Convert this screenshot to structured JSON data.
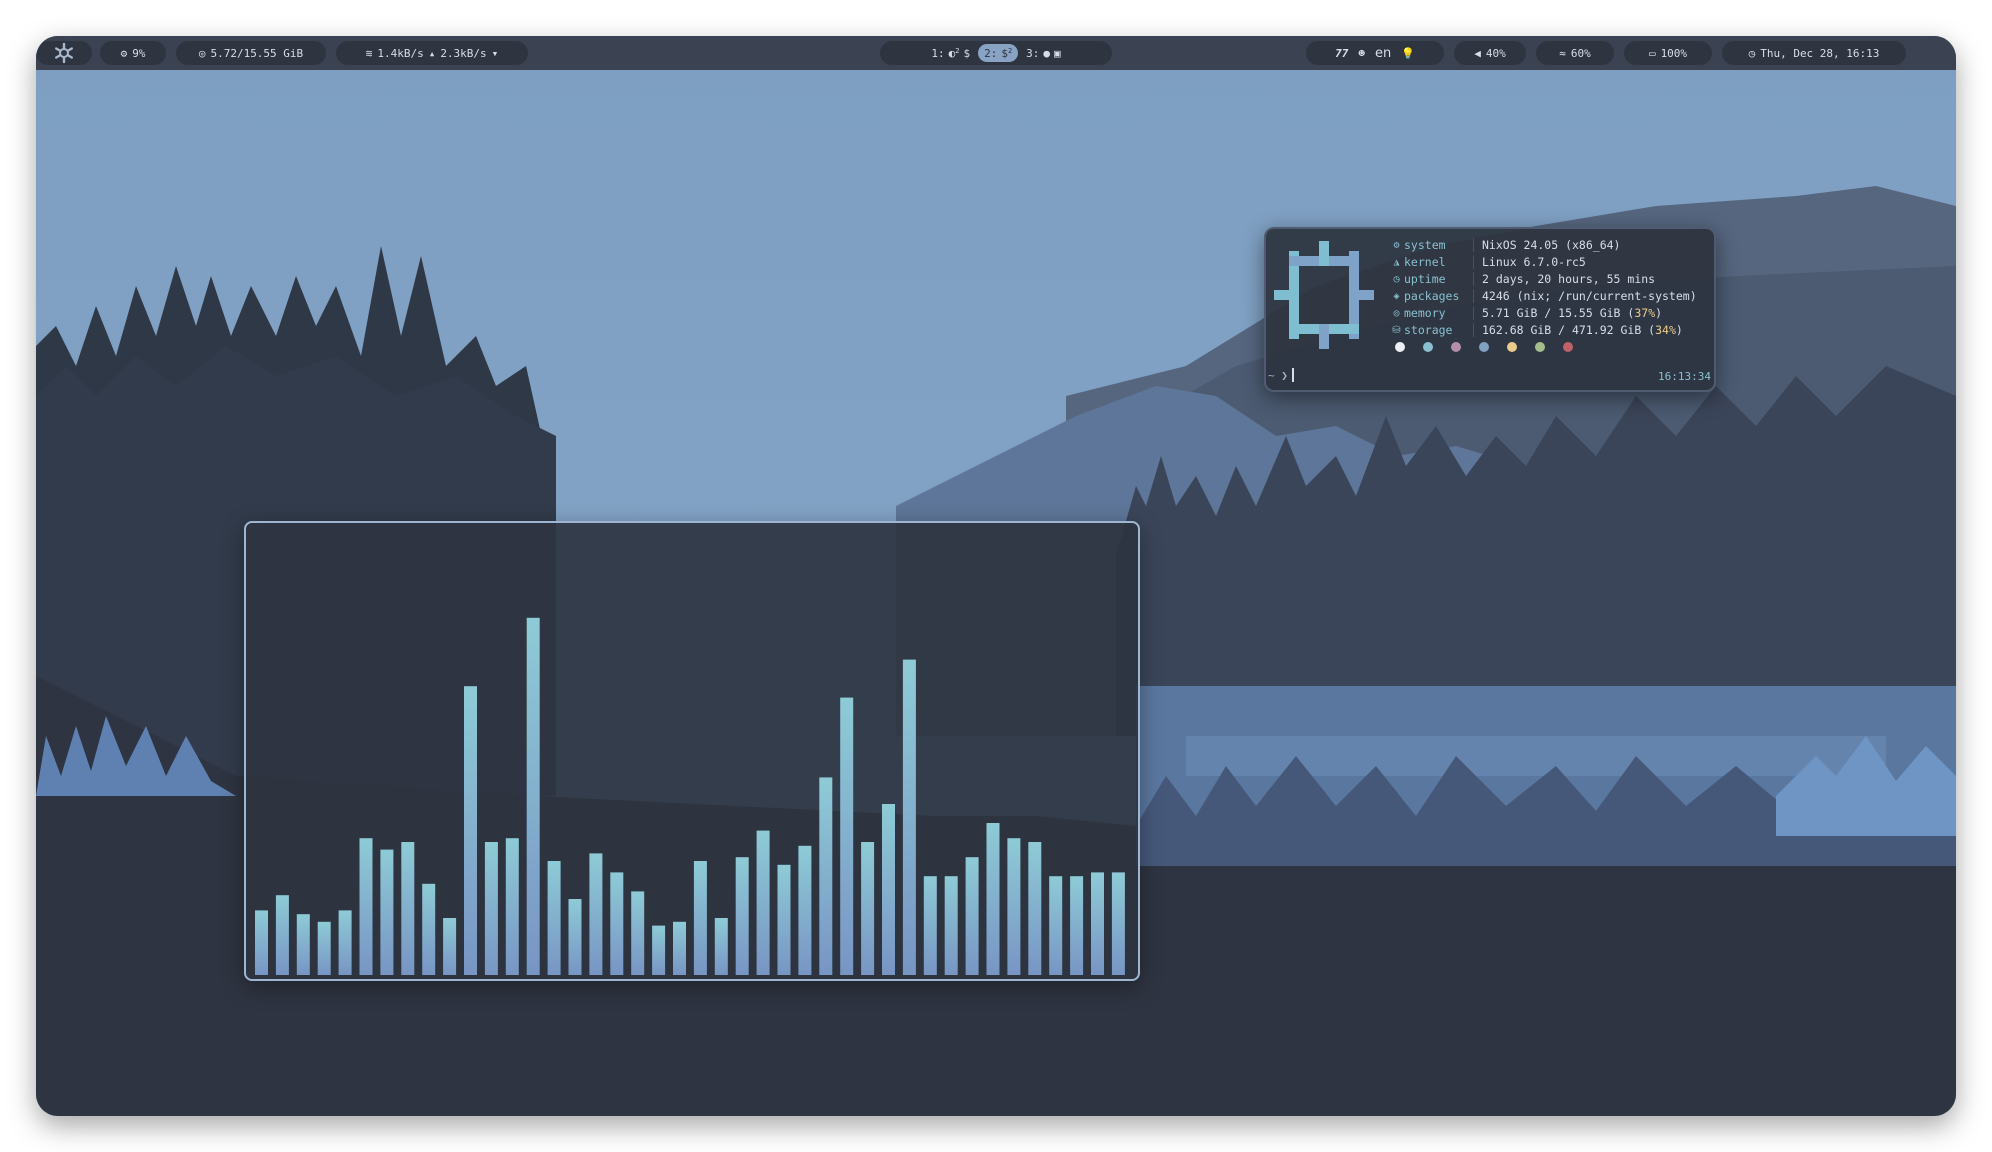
{
  "topbar": {
    "cpu": "9%",
    "ram": "5.72/15.55 GiB",
    "net_down": "1.4kB/s",
    "net_up": "2.3kB/s",
    "workspaces": [
      {
        "label": "1:",
        "superscript": "2",
        "active": false
      },
      {
        "label": "2:",
        "superscript": "2",
        "active": true
      },
      {
        "label": "3:",
        "active": false
      }
    ],
    "keyboard_layout": "en",
    "volume": "40%",
    "wifi": "60%",
    "battery": "100%",
    "datetime": "Thu, Dec 28, 16:13"
  },
  "fetch": {
    "rows": [
      {
        "key": "system",
        "icon": "gear-icon",
        "value": "NixOS 24.05 (x86_64)"
      },
      {
        "key": "kernel",
        "icon": "penguin-icon",
        "value": "Linux 6.7.0-rc5"
      },
      {
        "key": "uptime",
        "icon": "clock-icon",
        "value": "2 days, 20 hours, 55 mins"
      },
      {
        "key": "packages",
        "icon": "package-icon",
        "value": "4246 (nix; /run/current-system)"
      },
      {
        "key": "memory",
        "icon": "memory-icon",
        "value": "5.71 GiB / 15.55 GiB",
        "percent": "37%"
      },
      {
        "key": "storage",
        "icon": "disk-icon",
        "value": "162.68 GiB / 471.92 GiB",
        "percent": "34%"
      }
    ],
    "palette": [
      "#eceff4",
      "#88c0d0",
      "#b48ead",
      "#81a1c1",
      "#ebcb8b",
      "#a3be8c",
      "#bf616a"
    ],
    "prompt": "~ ❯",
    "clock": "16:13:34"
  },
  "visualizer": {
    "levels": [
      0.17,
      0.21,
      0.16,
      0.14,
      0.17,
      0.36,
      0.33,
      0.35,
      0.24,
      0.15,
      0.76,
      0.35,
      0.36,
      0.94,
      0.3,
      0.2,
      0.32,
      0.27,
      0.22,
      0.13,
      0.14,
      0.3,
      0.15,
      0.31,
      0.38,
      0.29,
      0.34,
      0.52,
      0.73,
      0.35,
      0.45,
      0.83,
      0.26,
      0.26,
      0.31,
      0.4,
      0.36,
      0.35,
      0.26,
      0.26,
      0.27,
      0.27
    ]
  },
  "colors": {
    "accent": "#88c0d0",
    "bar_bg": "#3b4252",
    "pill_bg": "#2e3440",
    "active_workspace": "#88a3c4",
    "sky": "#7f9fc1"
  }
}
